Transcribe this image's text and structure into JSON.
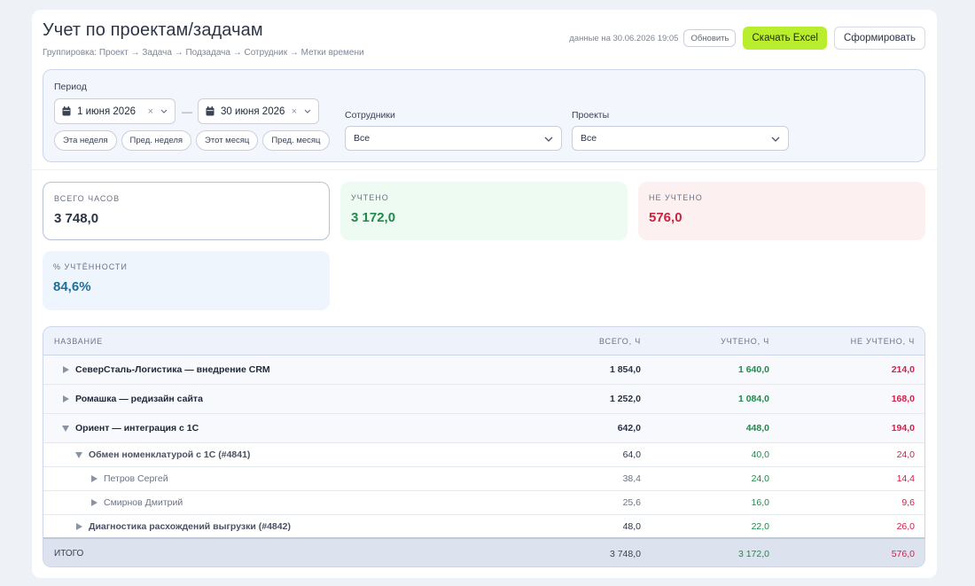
{
  "header": {
    "title": "Учет по проектам/задачам",
    "grouping": "Группировка: Проект → Задача → Подзадача → Сотрудник → Метки времени",
    "data_date": "данные на 30.06.2026 19:05",
    "refresh_label": "Обновить",
    "excel_label": "Скачать Excel",
    "form_label": "Сформировать"
  },
  "filters": {
    "period_label": "Период",
    "date_from": "1 июня 2026",
    "date_to": "30 июня 2026",
    "dash": "—",
    "clear_symbol": "×",
    "quick": [
      "Эта неделя",
      "Пред. неделя",
      "Этот месяц",
      "Пред. месяц"
    ],
    "employees_label": "Сотрудники",
    "employees_value": "Все",
    "projects_label": "Проекты",
    "projects_value": "Все"
  },
  "stats": {
    "total": {
      "label": "ВСЕГО ЧАСОВ",
      "value": "3 748,0",
      "color": "#2b3445"
    },
    "counted": {
      "label": "УЧТЕНО",
      "value": "3 172,0",
      "color": "#1f8a4a"
    },
    "not_counted": {
      "label": "НЕ УЧТЕНО",
      "value": "576,0",
      "color": "#c8233f"
    },
    "percent": {
      "label": "% УЧТЁННОСТИ",
      "value": "84,6%",
      "color": "#1f6f95"
    }
  },
  "table": {
    "columns": [
      "НАЗВАНИЕ",
      "ВСЕГО, Ч",
      "УЧТЕНО, Ч",
      "НЕ УЧТЕНО, Ч"
    ],
    "rows": [
      {
        "name": "СеверСталь-Логистика — внедрение CRM",
        "total": "1 854,0",
        "counted": "1 640,0",
        "not_counted": "214,0"
      },
      {
        "name": "Ромашка — редизайн сайта",
        "total": "1 252,0",
        "counted": "1 084,0",
        "not_counted": "168,0"
      },
      {
        "name": "Ориент — интеграция с 1С",
        "total": "642,0",
        "counted": "448,0",
        "not_counted": "194,0"
      },
      {
        "name": "Обмен номенклатурой с 1С (#4841)",
        "total": "64,0",
        "counted": "40,0",
        "not_counted": "24,0"
      },
      {
        "name": "Петров Сергей",
        "total": "38,4",
        "counted": "24,0",
        "not_counted": "14,4"
      },
      {
        "name": "Смирнов Дмитрий",
        "total": "25,6",
        "counted": "16,0",
        "not_counted": "9,6"
      },
      {
        "name": "Диагностика расхождений выгрузки (#4842)",
        "total": "48,0",
        "counted": "22,0",
        "not_counted": "26,0"
      }
    ],
    "footer": {
      "name": "ИТОГО",
      "total": "3 748,0",
      "counted": "3 172,0",
      "not_counted": "576,0"
    }
  }
}
